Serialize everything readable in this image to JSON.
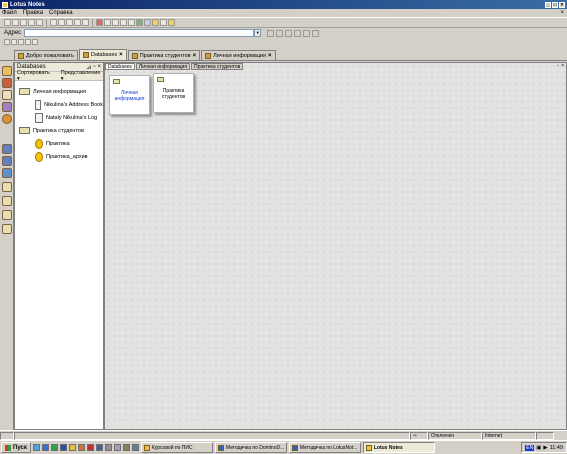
{
  "window": {
    "title": "Lotus Notes"
  },
  "menu": [
    "Файл",
    "Правка",
    "Справка"
  ],
  "address": {
    "label": "Адрес",
    "value": ""
  },
  "tabs": [
    {
      "label": "Добро пожаловать",
      "active": false
    },
    {
      "label": "Databases",
      "active": true
    },
    {
      "label": "Практика студентов",
      "active": false
    },
    {
      "label": "Личная информация",
      "active": false
    }
  ],
  "navpane": {
    "title": "Databases",
    "sort_label": "Сортировать",
    "view_label": "Представление",
    "tree": [
      {
        "label": "Личная информация",
        "level": 1,
        "kind": "folder"
      },
      {
        "label": "Nikulina's Address Book",
        "level": 2,
        "kind": "db"
      },
      {
        "label": "Nataly Nikulina's Log",
        "level": 2,
        "kind": "db"
      },
      {
        "label": "Практика студентов",
        "level": 1,
        "kind": "folder"
      },
      {
        "label": "Практика",
        "level": 2,
        "kind": "db-yellow"
      },
      {
        "label": "Практика_архив",
        "level": 2,
        "kind": "db-yellow"
      }
    ]
  },
  "main": {
    "tabs": [
      "Databases",
      "Личная информация",
      "Практика студентов"
    ],
    "cards": [
      {
        "label_line1": "Личная",
        "label_line2": "информация"
      },
      {
        "label_line1": "Практика",
        "label_line2": "студентов"
      }
    ]
  },
  "statusbar": {
    "offline": "Отключен",
    "location": "Internet"
  },
  "taskbar": {
    "start": "Пуск",
    "tasks": [
      {
        "label": "Курсовой по ПИС",
        "active": false
      },
      {
        "label": "Методичка по DominoD...",
        "active": false
      },
      {
        "label": "Методичка по LotusNot...",
        "active": false
      },
      {
        "label": "Lotus Notes",
        "active": true
      }
    ],
    "lang": "EN",
    "time": "11:49"
  }
}
